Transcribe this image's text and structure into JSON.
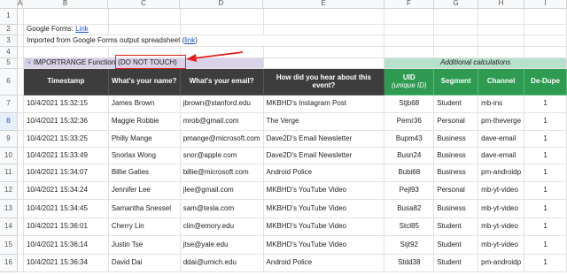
{
  "column_headers": [
    "A",
    "B",
    "C",
    "D",
    "E",
    "F",
    "G",
    "H",
    "I"
  ],
  "row_numbers": [
    "1",
    "2",
    "3",
    "4",
    "5",
    "6",
    "7",
    "8",
    "9",
    "10",
    "11",
    "12",
    "13",
    "14",
    "15",
    "16"
  ],
  "notes": {
    "forms_label": "Google Forms: ",
    "forms_link": "Link",
    "imported_label": "Imported from Google Forms output spreadsheet (",
    "imported_link": "link",
    "imported_close": ")"
  },
  "import_banner": {
    "icon": "hand-pointer-icon",
    "text": "IMPORTRANGE Function",
    "warning": "(DO NOT TOUCH)"
  },
  "additional_calculations": "Additional calculations",
  "headers": {
    "timestamp": "Timestamp",
    "name": "What's your name?",
    "email": "What's your email?",
    "hear": "How did you hear about this event?",
    "uid": "UID",
    "uid_sub": "(unique ID)",
    "segment": "Segment",
    "channel": "Channel",
    "dedupe": "De-Dupe"
  },
  "rows": [
    {
      "timestamp": "10/4/2021 15:32:15",
      "name": "James Brown",
      "email": "jbrown@stanford.edu",
      "hear": "MKBHD's Instagram Post",
      "uid": "Stjb68",
      "segment": "Student",
      "channel": "mb-ins",
      "dedupe": "1"
    },
    {
      "timestamp": "10/4/2021 15:32:36",
      "name": "Maggie Robbie",
      "email": "mrob@gmail.com",
      "hear": "The Verge",
      "uid": "Pemr36",
      "segment": "Personal",
      "channel": "pm-theverge",
      "dedupe": "1"
    },
    {
      "timestamp": "10/4/2021 15:33:25",
      "name": "Philly Mange",
      "email": "pmange@microsoft.com",
      "hear": "Dave2D's Email Newsletter",
      "uid": "Bupm43",
      "segment": "Business",
      "channel": "dave-email",
      "dedupe": "1"
    },
    {
      "timestamp": "10/4/2021 15:33:49",
      "name": "Snorlax Wong",
      "email": "snor@apple.com",
      "hear": "Dave2D's Email Newsletter",
      "uid": "Busn24",
      "segment": "Business",
      "channel": "dave-email",
      "dedupe": "1"
    },
    {
      "timestamp": "10/4/2021 15:34:07",
      "name": "Billie Gaties",
      "email": "billie@microsoft.com",
      "hear": "Android Police",
      "uid": "Bubi68",
      "segment": "Business",
      "channel": "pm-androidp",
      "dedupe": "1"
    },
    {
      "timestamp": "10/4/2021 15:34:24",
      "name": "Jennifer Lee",
      "email": "jlee@gmail.com",
      "hear": "MKBHD's YouTube Video",
      "uid": "Pejl93",
      "segment": "Personal",
      "channel": "mb-yt-video",
      "dedupe": "1"
    },
    {
      "timestamp": "10/4/2021 15:34:45",
      "name": "Samantha Snessel",
      "email": "sam@tesla.com",
      "hear": "MKBHD's YouTube Video",
      "uid": "Busa82",
      "segment": "Business",
      "channel": "mb-yt-video",
      "dedupe": "1"
    },
    {
      "timestamp": "10/4/2021 15:36:01",
      "name": "Cherry Lin",
      "email": "clin@emory.edu",
      "hear": "MKBHD's YouTube Video",
      "uid": "Stcl85",
      "segment": "Student",
      "channel": "mb-yt-video",
      "dedupe": "1"
    },
    {
      "timestamp": "10/4/2021 15:36:14",
      "name": "Justin Tse",
      "email": "jtse@yale.edu",
      "hear": "MKBHD's YouTube Video",
      "uid": "Stjt92",
      "segment": "Student",
      "channel": "mb-yt-video",
      "dedupe": "1"
    },
    {
      "timestamp": "10/4/2021 15:36:34",
      "name": "David Dai",
      "email": "ddai@umich.edu",
      "hear": "Android Police",
      "uid": "Stdd38",
      "segment": "Student",
      "channel": "pm-androidp",
      "dedupe": "1"
    }
  ],
  "colors": {
    "dark_header": "#3d3d3d",
    "green_header": "#2e9a52",
    "purple_banner": "#d9d2e9",
    "green_banner": "#b7e1cd",
    "annotation_red": "#e02020",
    "link_blue": "#1a55c8"
  }
}
